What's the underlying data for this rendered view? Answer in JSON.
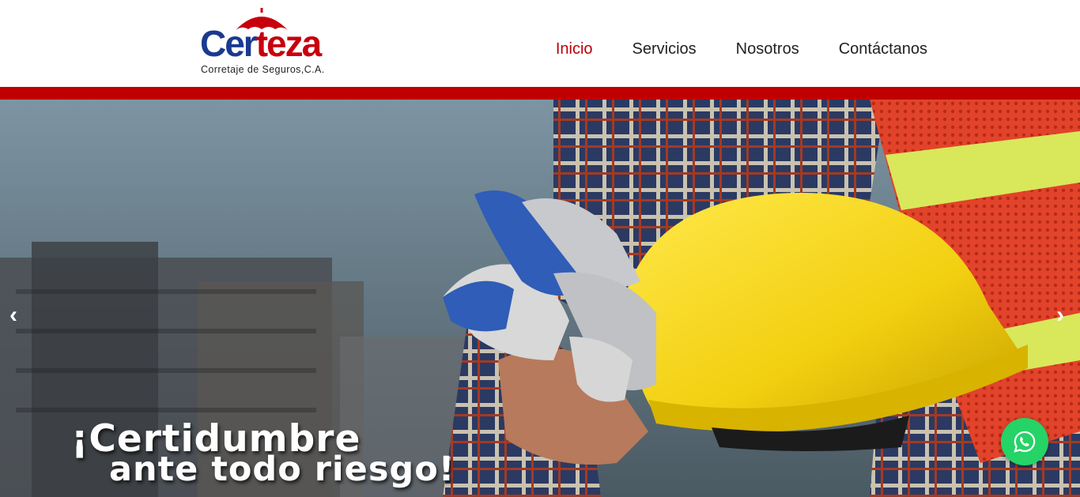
{
  "brand": {
    "name_part1": "Cer",
    "name_part2": "teza",
    "tagline": "Corretaje de Seguros,C.A."
  },
  "nav": {
    "items": [
      {
        "label": "Inicio",
        "active": true
      },
      {
        "label": "Servicios",
        "active": false
      },
      {
        "label": "Nosotros",
        "active": false
      },
      {
        "label": "Contáctanos",
        "active": false
      }
    ]
  },
  "hero": {
    "slogan_line1": "¡Certidumbre",
    "slogan_line2": "ante todo riesgo!",
    "prev_arrow": "‹",
    "next_arrow": "›"
  },
  "colors": {
    "brand_blue": "#1a3a8f",
    "brand_red": "#c8000e",
    "bar_red": "#c00000",
    "whatsapp_green": "#25d366"
  },
  "icons": {
    "logo_mark": "umbrella-icon",
    "chat": "whatsapp-icon"
  }
}
